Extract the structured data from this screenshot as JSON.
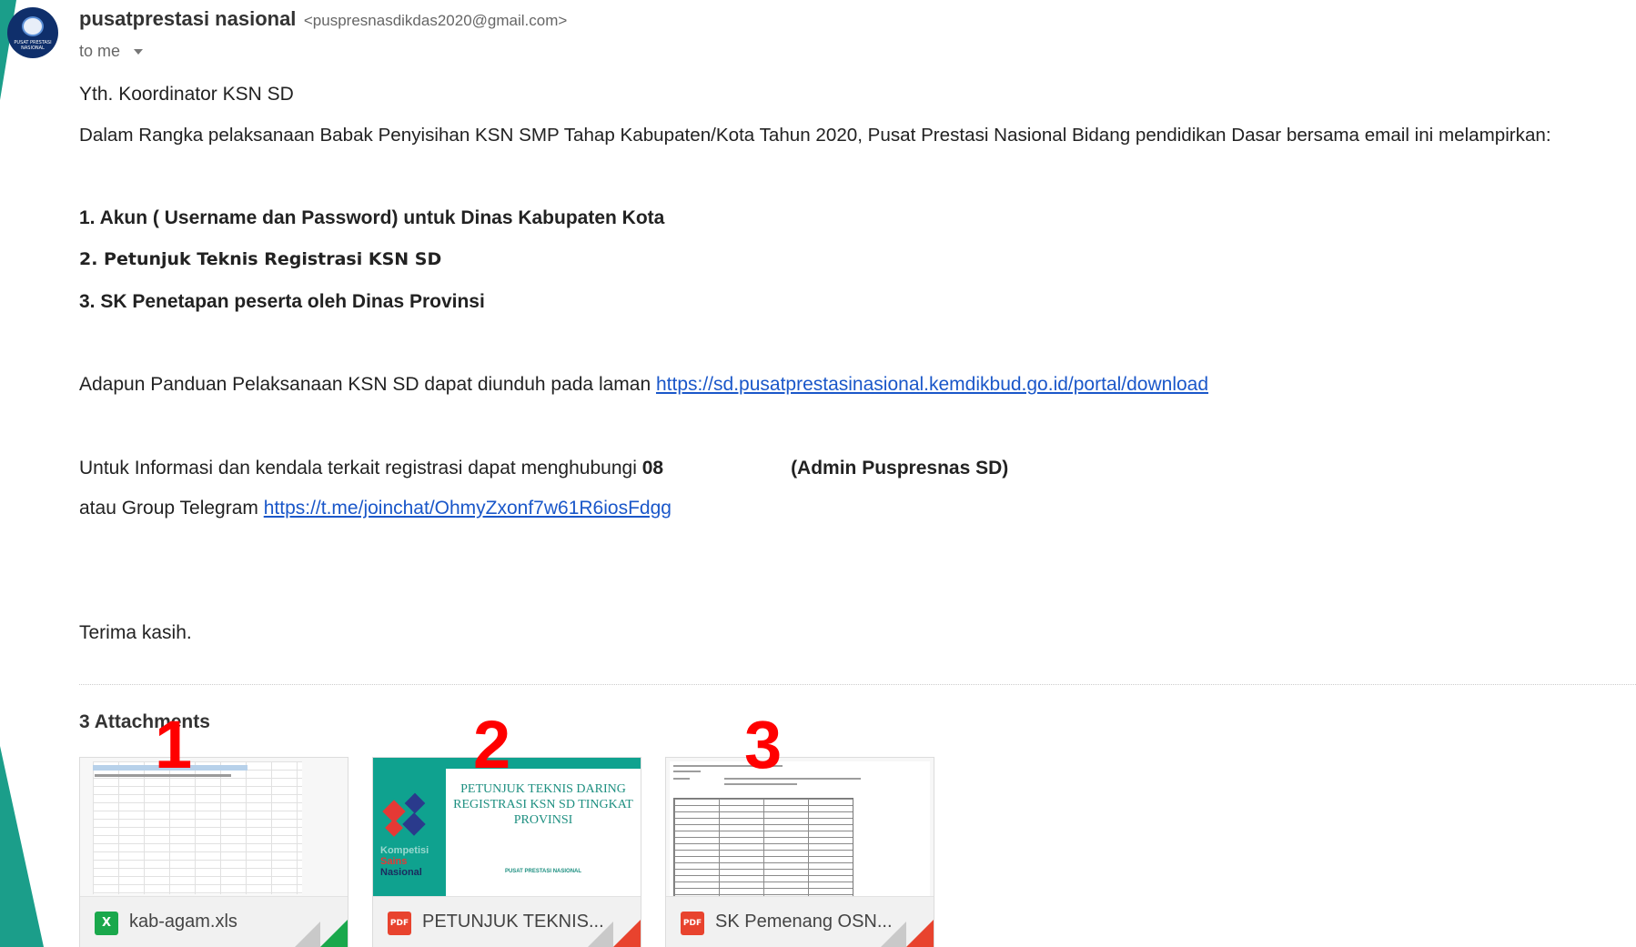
{
  "colors": {
    "accent_teal": "#1b9e8a",
    "link": "#1a57c9",
    "excel_green": "#1aa84c",
    "pdf_red": "#e8432e",
    "marker_red": "#ff0000"
  },
  "avatar": {
    "icon": "pusprenas-logo",
    "text": "PUSAT PRESTASI NASIONAL"
  },
  "header": {
    "sender_name": "pusatprestasi nasional",
    "sender_email": "<puspresnasdikdas2020@gmail.com>",
    "to_label": "to me"
  },
  "body": {
    "greeting": "Yth. Koordinator KSN SD",
    "intro": "Dalam Rangka pelaksanaan Babak Penyisihan KSN SMP Tahap Kabupaten/Kota Tahun 2020, Pusat Prestasi Nasional Bidang pendidikan Dasar bersama email ini melampirkan:",
    "list": [
      "1. Akun ( Username dan Password) untuk Dinas Kabupaten Kota",
      "2. Petunjuk Teknis Registrasi KSN SD",
      "3. SK Penetapan peserta oleh Dinas Provinsi"
    ],
    "panduan_text": "Adapun Panduan Pelaksanaan KSN SD dapat diunduh pada laman ",
    "panduan_link": "https://sd.pusatprestasinasional.kemdikbud.go.id/portal/download",
    "info_text": "Untuk Informasi dan kendala terkait registrasi dapat menghubungi ",
    "info_phone": "08",
    "info_admin": "(Admin Puspresnas SD)",
    "telegram_text": "atau Group Telegram ",
    "telegram_link": "https://t.me/joinchat/OhmyZxonf7w61R6iosFdgg",
    "closing": "Terima kasih."
  },
  "attachments": {
    "title": "3 Attachments",
    "items": [
      {
        "marker": "1",
        "type_label": "X",
        "name": "kab-agam.xls",
        "icon": "excel-icon"
      },
      {
        "marker": "2",
        "type_label": "PDF",
        "name": "PETUNJUK TEKNIS...",
        "icon": "pdf-icon",
        "preview_title": "PETUNJUK TEKNIS DARING REGISTRASI KSN SD TINGKAT PROVINSI",
        "preview_sub": "PUSAT PRESTASI NASIONAL",
        "brand_lines": [
          "Kompetisi",
          "Sains",
          "Nasional"
        ]
      },
      {
        "marker": "3",
        "type_label": "PDF",
        "name": "SK Pemenang OSN...",
        "icon": "pdf-icon"
      }
    ]
  }
}
